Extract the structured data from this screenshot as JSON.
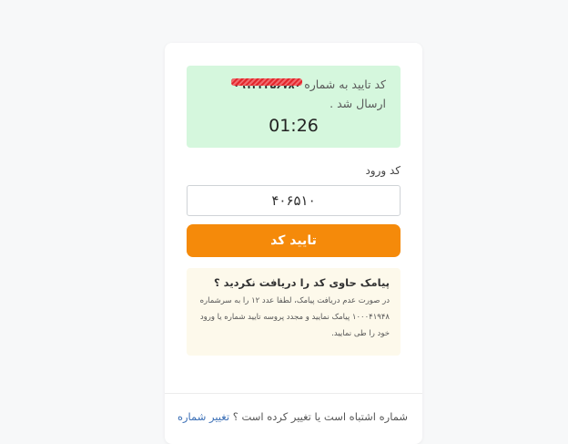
{
  "notice": {
    "prefix": "کد تایید به شماره",
    "masked_number": "۰۹۱۲۳۴۵۶۷۸۰",
    "suffix": "ارسال شد .",
    "timer": "01:26"
  },
  "code_field": {
    "label": "کد ورود",
    "value": "۴۰۶۵۱۰"
  },
  "confirm_button": {
    "label": "تایید کد"
  },
  "sms_help": {
    "title": "پیامک حاوی کد را دریافت نکردید ؟",
    "body": "در صورت عدم دریافت پیامک، لطفا عدد ۱۲ را به سرشماره ۱۰۰۰۴۱۹۴۸ پیامک نمایید و مجدد پروسه تایید شماره یا ورود خود را طی نمایید."
  },
  "footer": {
    "question": "شماره اشتباه است یا تغییر کرده است ؟",
    "change_link": "تغییر شماره"
  },
  "colors": {
    "notice_bg": "#d5f7dd",
    "button_bg": "#f58a0a",
    "help_bg": "#fdf9eb",
    "link": "#3b6fb6"
  }
}
